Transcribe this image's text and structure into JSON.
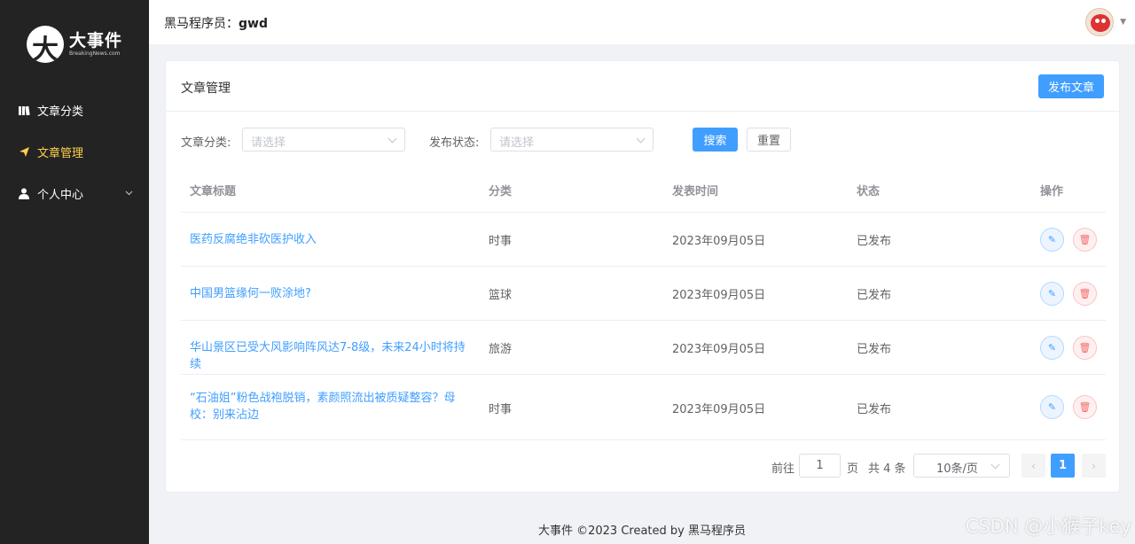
{
  "app": {
    "logo_title": "大事件",
    "logo_sub": "BreakingNews.com"
  },
  "sidebar": {
    "items": [
      {
        "label": "文章分类",
        "icon": "book-icon",
        "active": false
      },
      {
        "label": "文章管理",
        "icon": "paper-plane-icon",
        "active": true
      },
      {
        "label": "个人中心",
        "icon": "user-icon",
        "active": false
      }
    ]
  },
  "header": {
    "prefix": "黑马程序员：",
    "username": "gwd"
  },
  "card": {
    "title": "文章管理",
    "publish_label": "发布文章"
  },
  "filter": {
    "category_label": "文章分类:",
    "category_placeholder": "请选择",
    "status_label": "发布状态:",
    "status_placeholder": "请选择",
    "search_label": "搜索",
    "reset_label": "重置"
  },
  "table": {
    "headers": [
      "文章标题",
      "分类",
      "发表时间",
      "状态",
      "操作"
    ],
    "rows": [
      {
        "title": "医药反腐绝非砍医护收入",
        "category": "时事",
        "time": "2023年09月05日",
        "status": "已发布"
      },
      {
        "title": "中国男篮缘何一败涂地?",
        "category": "篮球",
        "time": "2023年09月05日",
        "status": "已发布"
      },
      {
        "title": "华山景区已受大风影响阵风达7-8级，未来24小时将持续",
        "category": "旅游",
        "time": "2023年09月05日",
        "status": "已发布"
      },
      {
        "title": "“石油姐”粉色战袍脱销，素颜照流出被质疑整容？母校：别来沾边",
        "category": "时事",
        "time": "2023年09月05日",
        "status": "已发布"
      }
    ]
  },
  "pagination": {
    "goto_label": "前往",
    "page_value": "1",
    "page_unit": "页",
    "total_text": "共 4 条",
    "page_size": "10条/页",
    "current_page": "1"
  },
  "footer": {
    "text": "大事件 ©2023 Created by 黑马程序员"
  },
  "watermark": "CSDN @小猴子key",
  "colors": {
    "primary": "#409eff",
    "sidebar_bg": "#232323",
    "active_menu": "#ffd04b",
    "danger": "#f56c6c"
  }
}
